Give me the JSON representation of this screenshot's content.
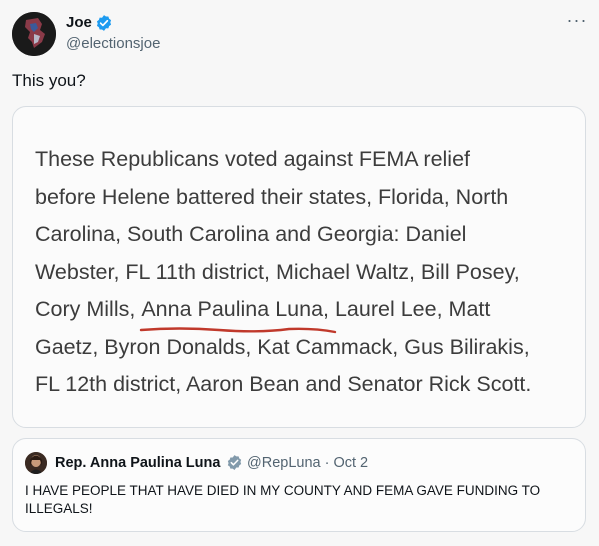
{
  "author": {
    "name": "Joe",
    "handle": "@electionsjoe"
  },
  "tweet": {
    "text": "This you?"
  },
  "image_text": {
    "line1": "These Republicans voted against FEMA relief",
    "line2": "before Helene battered their states, Florida, North",
    "line3": "Carolina, South Carolina and Georgia: Daniel",
    "line4": "Webster, FL 11th district, Michael Waltz, Bill Posey,",
    "line5_before": "Cory Mills, ",
    "line5_name": "Anna Paulina Luna",
    "line5_after": ", Laurel Lee, Matt",
    "line6": "Gaetz, Byron Donalds, Kat Cammack, Gus Bilirakis,",
    "line7": "FL 12th district, Aaron Bean and Senator Rick Scott."
  },
  "quote": {
    "name": "Rep. Anna Paulina Luna",
    "meta": "@RepLuna · Oct 2",
    "text": "I HAVE PEOPLE THAT HAVE DIED IN MY COUNTY AND FEMA GAVE FUNDING TO ILLEGALS!"
  },
  "icons": {
    "verified": "verified-badge-icon",
    "more": "more-icon"
  },
  "colors": {
    "verified": "#1d9bf0",
    "underline": "#c0392b",
    "handle": "#536471"
  }
}
